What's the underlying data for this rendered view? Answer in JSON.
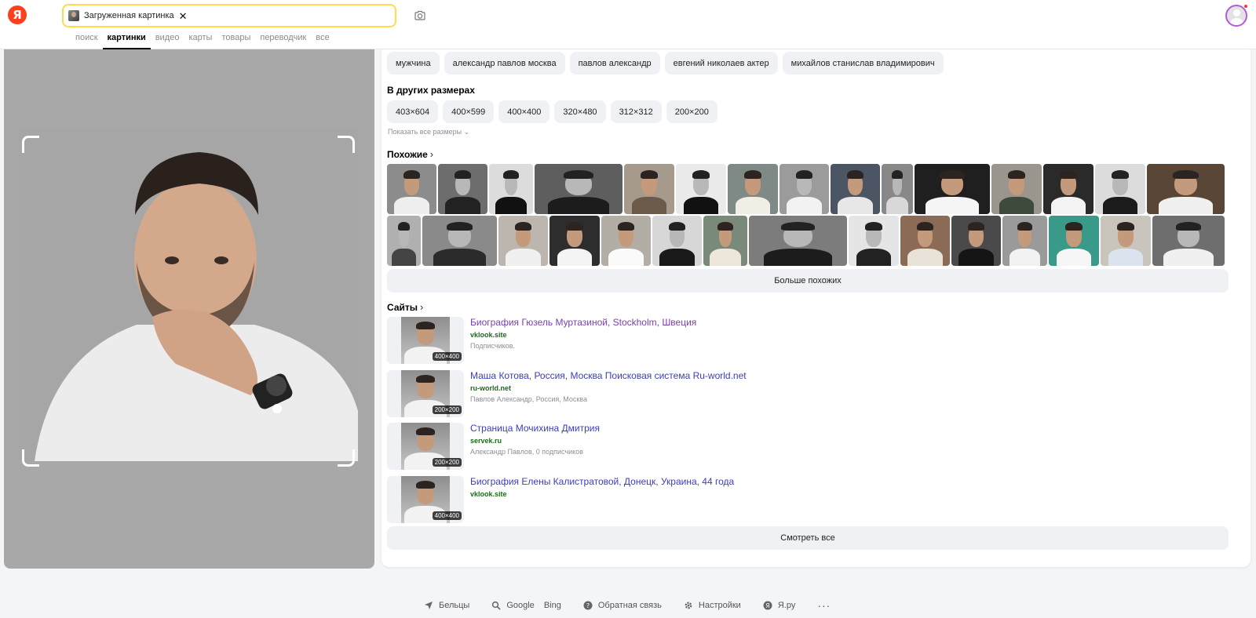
{
  "header": {
    "logo_text": "Я",
    "search_chip_label": "Загруженная картинка",
    "tabs": [
      {
        "label": "поиск"
      },
      {
        "label": "картинки"
      },
      {
        "label": "видео"
      },
      {
        "label": "карты"
      },
      {
        "label": "товары"
      },
      {
        "label": "переводчик"
      },
      {
        "label": "все"
      }
    ],
    "active_tab": "картинки"
  },
  "tags": [
    "мужчина",
    "александр павлов москва",
    "павлов александр",
    "евгений николаев актер",
    "михайлов станислав владимирович"
  ],
  "other_sizes": {
    "title": "В других размерах",
    "sizes": [
      "403×604",
      "400×599",
      "400×400",
      "320×480",
      "312×312",
      "200×200"
    ],
    "show_all_label": "Показать все размеры"
  },
  "similar": {
    "title": "Похожие",
    "more_label": "Больше похожих"
  },
  "sites": {
    "title": "Сайты",
    "items": [
      {
        "title": "Биография Гюзель Муртазиной, Stockholm, Швеция",
        "domain": "vklook.site",
        "desc": "Подписчиков.",
        "size": "400×400"
      },
      {
        "title": "Маша Котова, Россия, Москва Поисковая система Ru-world.net",
        "domain": "ru-world.net",
        "desc": "Павлов Александр, Россия, Москва",
        "size": "200×200"
      },
      {
        "title": "Страница Мочихина Дмитрия",
        "domain": "servek.ru",
        "desc": "Александр Павлов, 0 подписчиков",
        "size": "200×200"
      },
      {
        "title": "Биография Елены Калистратовой, Донецк, Украина, 44 года",
        "domain": "vklook.site",
        "desc": "",
        "size": "400×400"
      }
    ],
    "see_all_label": "Смотреть все"
  },
  "footer": {
    "items": [
      "Бельцы",
      "Google",
      "Bing",
      "Обратная связь",
      "Настройки",
      "Я.ру"
    ],
    "more_label": "···"
  }
}
